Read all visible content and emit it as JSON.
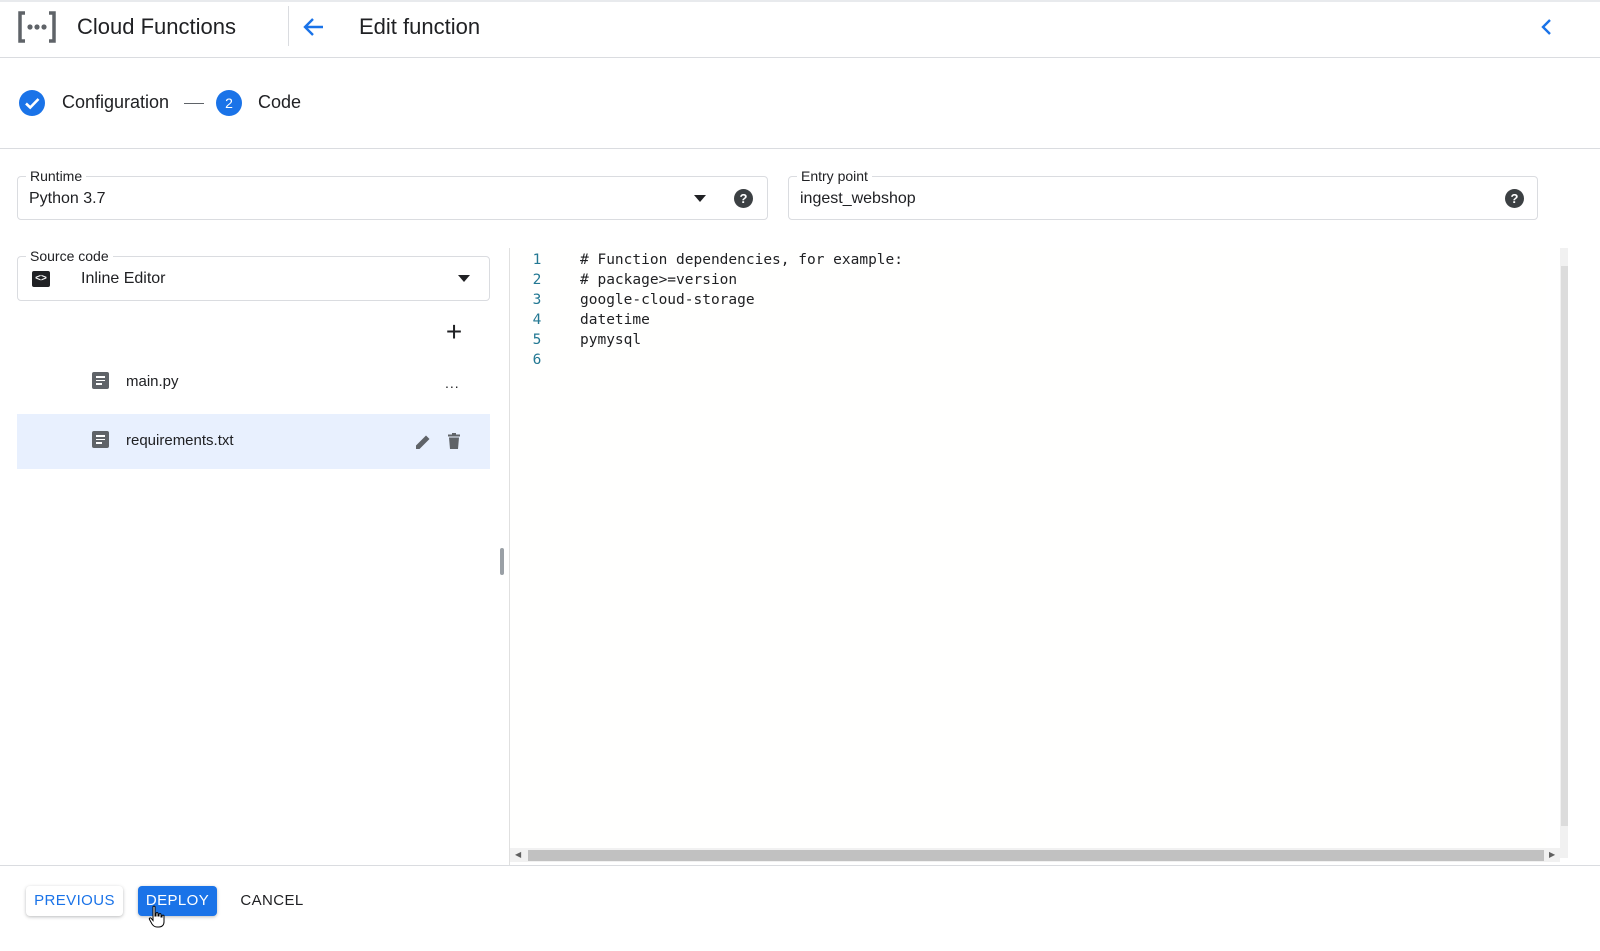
{
  "header": {
    "product_name": "Cloud Functions",
    "page_title": "Edit function",
    "icons": [
      "cloud-functions-logo",
      "arrow-back-icon",
      "chevron-left-icon"
    ]
  },
  "stepper": {
    "steps": [
      {
        "label": "Configuration",
        "state": "completed"
      },
      {
        "label": "Code",
        "number": "2",
        "state": "active"
      }
    ]
  },
  "runtime": {
    "label": "Runtime",
    "value": "Python 3.7"
  },
  "entry_point": {
    "label": "Entry point",
    "value": "ingest_webshop"
  },
  "source_code": {
    "label": "Source code",
    "value": "Inline Editor"
  },
  "files": [
    {
      "name": "main.py",
      "selected": false
    },
    {
      "name": "requirements.txt",
      "selected": true
    }
  ],
  "file_actions": {
    "more": "..."
  },
  "editor": {
    "lines": [
      {
        "n": "1",
        "text": "# Function dependencies, for example:"
      },
      {
        "n": "2",
        "text": "# package>=version"
      },
      {
        "n": "3",
        "text": "google-cloud-storage"
      },
      {
        "n": "4",
        "text": "datetime"
      },
      {
        "n": "5",
        "text": "pymysql"
      },
      {
        "n": "6",
        "text": ""
      }
    ]
  },
  "footer": {
    "previous": "PREVIOUS",
    "deploy": "DEPLOY",
    "cancel": "CANCEL"
  },
  "colors": {
    "accent": "#1a73e8",
    "selected_row": "#e8f0fe",
    "line_number": "#237893"
  }
}
